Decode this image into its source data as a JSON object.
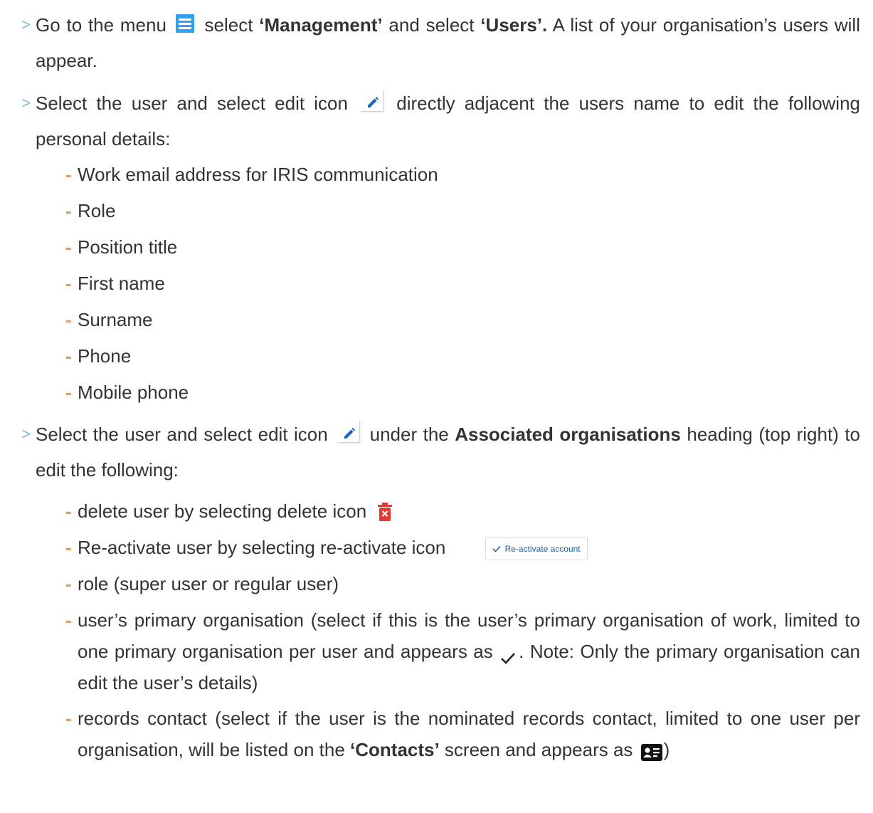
{
  "p1": {
    "a": "Go to the menu ",
    "b": " select ",
    "bold1": "‘Management’",
    "c": " and select ",
    "bold2": "‘Users’.",
    "d": " A list of your organisation’s users will appear."
  },
  "p2": {
    "a": "Select the user and select edit icon ",
    "b": " directly adjacent the users name to edit the following personal details:",
    "items": [
      "Work email address for IRIS communication",
      "Role",
      "Position title",
      "First name",
      "Surname",
      "Phone",
      "Mobile phone"
    ]
  },
  "p3": {
    "a": "Select the user and select edit icon ",
    "b": " under the ",
    "bold1": "Associated organisations",
    "c": " heading (top right) to edit the following:",
    "i1": "delete user by selecting delete icon ",
    "i2": "Re-activate user by selecting re-activate icon ",
    "react_label": "Re-activate account",
    "i3": "role (super user or regular user)",
    "i4a": "user’s primary organisation (select if this is the user’s primary organisation of work, limited to one primary organisation per user and appears as ",
    "i4b": ". Note: Only the primary organisation can edit the user’s details)",
    "i5a": "records contact (select if the user is the nominated records contact, limited to one user per organisation, will be listed on the ",
    "i5bold": "‘Contacts’",
    "i5b": " screen and appears as ",
    "i5c": ")"
  },
  "colors": {
    "menu_icon": "#2aa3f3",
    "delete_icon": "#e53935",
    "link_blue": "#1c63a8",
    "arrow": "#7fbfcf",
    "dash": "#e39a57"
  }
}
